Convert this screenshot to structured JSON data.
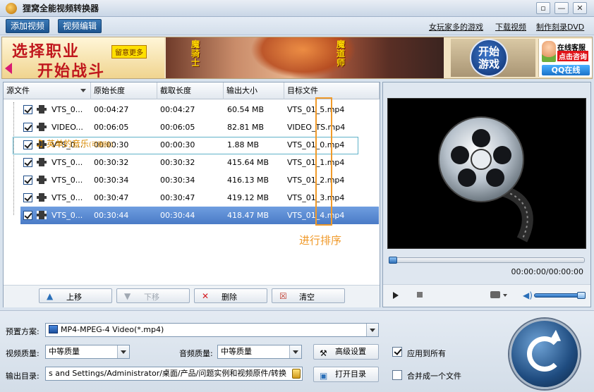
{
  "window": {
    "title": "狸窝全能视频转换器",
    "controls": [
      "▫",
      "—",
      "✕"
    ]
  },
  "toolbar": {
    "add_video": "添加视频",
    "edit_video": "视频编辑",
    "links": [
      "女玩家多的游戏",
      "下载视频",
      "制作刻录DVD"
    ]
  },
  "banner": {
    "line1": "选择职业",
    "line2": "开始战斗",
    "tag": "留意更多",
    "vertical1": "魔骑士",
    "vertical2": "魔道师",
    "play_line1": "开始",
    "play_line2": "游戏",
    "service1": "在线客服",
    "service2": "点击咨询",
    "service3": "QQ在线"
  },
  "file_list": {
    "columns": [
      "源文件",
      "原始长度",
      "截取长度",
      "输出大小",
      "目标文件"
    ],
    "rows": [
      {
        "name": "VTS_0...",
        "orig": "00:04:27",
        "cut": "00:04:27",
        "size": "60.54 MB",
        "target": "VTS_01_5.mp4",
        "selected": false
      },
      {
        "name": "VIDEO...",
        "orig": "00:06:05",
        "cut": "00:06:05",
        "size": "82.81 MB",
        "target": "VIDEO_TS.mp4",
        "selected": false
      },
      {
        "name": "VTS_0...",
        "orig": "00:00:30",
        "cut": "00:00:30",
        "size": "1.88 MB",
        "target": "VTS_01_0.mp4",
        "selected": false
      },
      {
        "name": "VTS_0...",
        "orig": "00:30:32",
        "cut": "00:30:32",
        "size": "415.64 MB",
        "target": "VTS_01_1.mp4",
        "selected": false
      },
      {
        "name": "VTS_0...",
        "orig": "00:30:34",
        "cut": "00:30:34",
        "size": "416.13 MB",
        "target": "VTS_01_2.mp4",
        "selected": false
      },
      {
        "name": "VTS_0...",
        "orig": "00:30:47",
        "cut": "00:30:47",
        "size": "419.12 MB",
        "target": "VTS_01_3.mp4",
        "selected": false
      },
      {
        "name": "VTS_0...",
        "orig": "00:30:44",
        "cut": "00:30:44",
        "size": "418.47 MB",
        "target": "VTS_01_4.mp4",
        "selected": true
      }
    ],
    "music_label": "英单的音乐",
    "music_note": "(可删除)",
    "annotation": "进行排序",
    "buttons": {
      "up": "上移",
      "down": "下移",
      "delete": "删除",
      "clear": "清空"
    }
  },
  "preview": {
    "time": "00:00:00/00:00:00"
  },
  "settings": {
    "preset_label": "预置方案:",
    "preset_value": "MP4-MPEG-4 Video(*.mp4)",
    "video_quality_label": "视频质量:",
    "video_quality_value": "中等质量",
    "audio_quality_label": "音频质量:",
    "audio_quality_value": "中等质量",
    "advanced": "高级设置",
    "apply_all": "应用到所有",
    "output_label": "输出目录:",
    "output_path": "s and Settings/Administrator/桌面/产品/问题实例和视频原件/转换",
    "open_dir": "打开目录",
    "merge": "合并成一个文件"
  }
}
